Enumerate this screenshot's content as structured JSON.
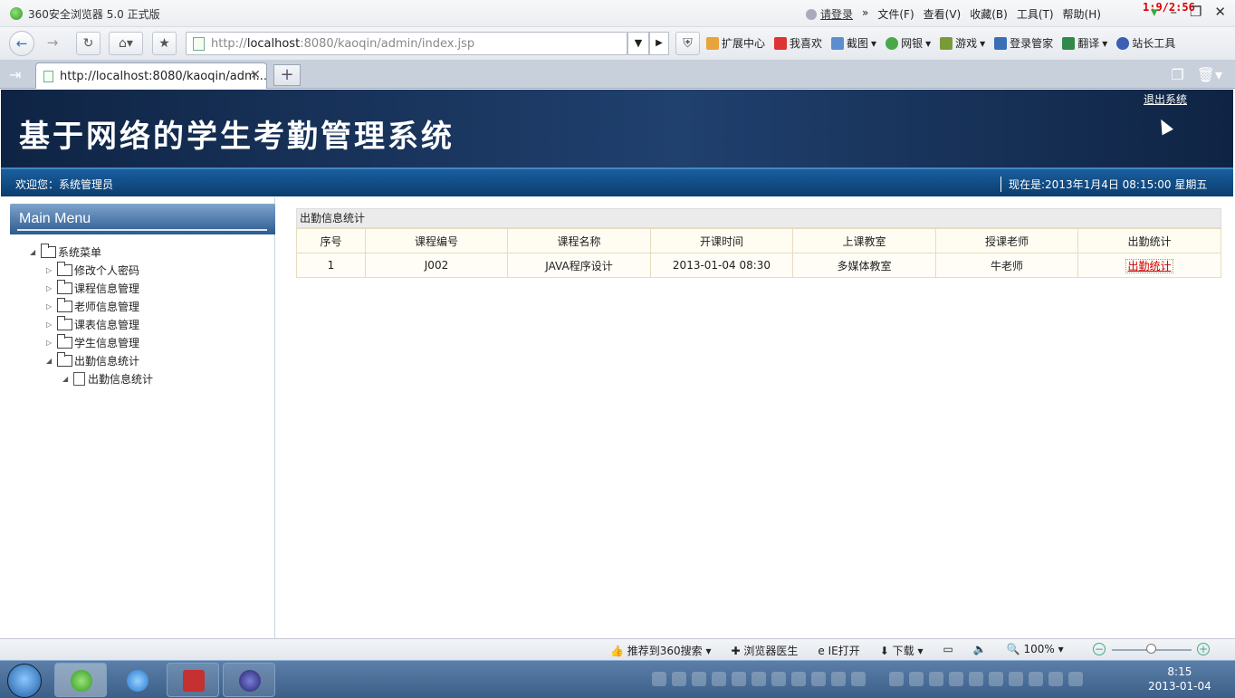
{
  "browser": {
    "window_title": "360安全浏览器 5.0 正式版",
    "counter": "1:9/2:56",
    "login_label": "请登录",
    "menus": [
      "文件(F)",
      "查看(V)",
      "收藏(B)",
      "工具(T)",
      "帮助(H)"
    ],
    "address": {
      "prefix": "http://",
      "host": "localhost",
      "rest": ":8080/kaoqin/admin/index.jsp"
    },
    "toolbar_items": [
      "扩展中心",
      "我喜欢",
      "截图",
      "网银",
      "游戏",
      "登录管家",
      "翻译",
      "站长工具"
    ],
    "tab_title": "http://localhost:8080/kaoqin/adm...",
    "status_items": [
      "推荐到360搜索",
      "浏览器医生",
      "IE打开",
      "下载",
      "100%"
    ]
  },
  "header": {
    "system_title": "基于网络的学生考勤管理系统",
    "logout": "退出系统",
    "welcome": "欢迎您：系统管理员",
    "now": "现在是:2013年1月4日  08:15:00 星期五"
  },
  "sidebar": {
    "heading": "Main Menu",
    "root": "系统菜单",
    "items": [
      "修改个人密码",
      "课程信息管理",
      "老师信息管理",
      "课表信息管理",
      "学生信息管理",
      "出勤信息统计"
    ],
    "sub_item": "出勤信息统计"
  },
  "main": {
    "table_title": "出勤信息统计",
    "headers": [
      "序号",
      "课程编号",
      "课程名称",
      "开课时间",
      "上课教室",
      "授课老师",
      "出勤统计"
    ],
    "rows": [
      {
        "no": "1",
        "code": "J002",
        "name": "JAVA程序设计",
        "time": "2013-01-04 08:30",
        "room": "多媒体教室",
        "teacher": "牛老师",
        "action": "出勤统计"
      }
    ]
  },
  "taskbar": {
    "time": "8:15",
    "date": "2013-01-04"
  }
}
